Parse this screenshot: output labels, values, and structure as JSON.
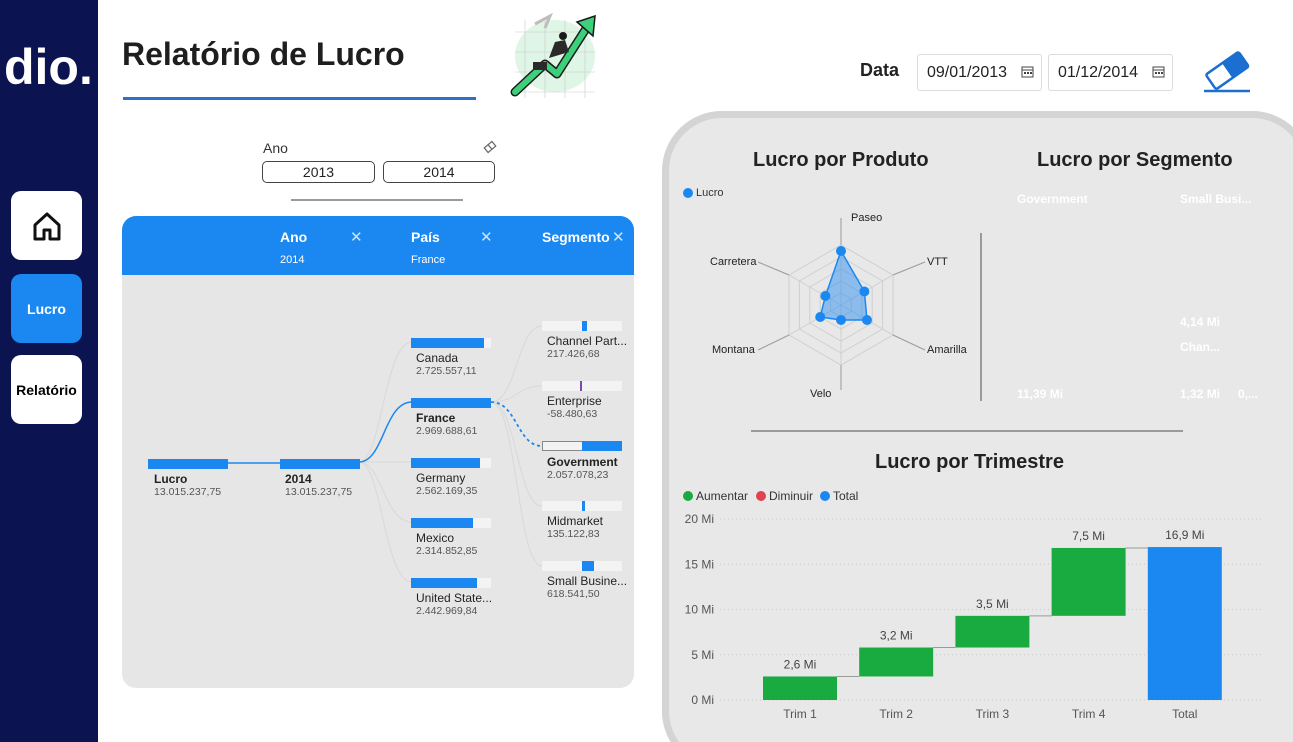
{
  "sidebar": {
    "logo_text": "dio.",
    "nav": [
      {
        "id": "home",
        "label": "",
        "icon": "home-icon"
      },
      {
        "id": "lucro",
        "label": "Lucro"
      },
      {
        "id": "relatorio",
        "label": "Relatório"
      }
    ]
  },
  "header": {
    "title": "Relatório de Lucro",
    "illustration_icon": "growth-chart-illustration",
    "date_label": "Data",
    "date_start": "09/01/2013",
    "date_end": "01/12/2014",
    "clear_icon": "eraser-icon"
  },
  "ano_slicer": {
    "label": "Ano",
    "options": [
      "2013",
      "2014"
    ]
  },
  "decomposition_tree": {
    "headers": [
      {
        "label": "Ano",
        "value": "2014"
      },
      {
        "label": "País",
        "value": "France"
      },
      {
        "label": "Segmento",
        "value": ""
      }
    ],
    "root": {
      "label": "Lucro",
      "value": "13.015.237,75",
      "fraction": 1.0
    },
    "level1": {
      "label": "2014",
      "value": "13.015.237,75",
      "fraction": 1.0
    },
    "countries": [
      {
        "label": "Canada",
        "value": "2.725.557,11",
        "fraction": 0.92
      },
      {
        "label": "France",
        "value": "2.969.688,61",
        "fraction": 1.0,
        "selected": true
      },
      {
        "label": "Germany",
        "value": "2.562.169,35",
        "fraction": 0.86
      },
      {
        "label": "Mexico",
        "value": "2.314.852,85",
        "fraction": 0.78
      },
      {
        "label": "United State...",
        "value": "2.442.969,84",
        "fraction": 0.82
      }
    ],
    "segments": [
      {
        "label": "Channel Part...",
        "value": "217.426,68",
        "fraction": 0.06
      },
      {
        "label": "Enterprise",
        "value": "-58.480,63",
        "fraction": -0.02
      },
      {
        "label": "Government",
        "value": "2.057.078,23",
        "fraction": 0.5,
        "selected": true
      },
      {
        "label": "Midmarket",
        "value": "135.122,83",
        "fraction": 0.04
      },
      {
        "label": "Small Busine...",
        "value": "618.541,50",
        "fraction": 0.15
      }
    ]
  },
  "radar": {
    "title": "Lucro por Produto",
    "legend": "Lucro",
    "axes": [
      "Paseo",
      "VTT",
      "Amarilla",
      "Velo",
      "Montana",
      "Carretera"
    ],
    "values": [
      0.9,
      0.45,
      0.5,
      0.25,
      0.4,
      0.3
    ]
  },
  "treemap": {
    "title": "Lucro por Segmento",
    "cells": [
      {
        "label": "Government",
        "value": "11,39 Mi",
        "color": "#1b88f2"
      },
      {
        "label": "Small Busi...",
        "value": "4,14 Mi",
        "color": "#13279b"
      },
      {
        "label": "Chan...",
        "value": "1,32 Mi",
        "color": "#e46c34"
      },
      {
        "label": "",
        "value": "0,...",
        "color": "#6b0a84"
      }
    ]
  },
  "chart_data": {
    "type": "bar",
    "title": "Lucro por Trimestre",
    "categories": [
      "Trim 1",
      "Trim 2",
      "Trim 3",
      "Trim 4",
      "Total"
    ],
    "series": [
      {
        "name": "Aumentar",
        "color": "#1aab40"
      },
      {
        "name": "Diminuir",
        "color": "#e0424f"
      },
      {
        "name": "Total",
        "color": "#1b88f2"
      }
    ],
    "values": [
      2.6,
      3.2,
      3.5,
      7.5,
      16.9
    ],
    "data_labels": [
      "2,6 Mi",
      "3,2 Mi",
      "3,5 Mi",
      "7,5 Mi",
      "16,9 Mi"
    ],
    "y_ticks": [
      "0 Mi",
      "5 Mi",
      "10 Mi",
      "15 Mi",
      "20 Mi"
    ],
    "ylim": [
      0,
      20
    ],
    "legend_position": "top-left"
  }
}
